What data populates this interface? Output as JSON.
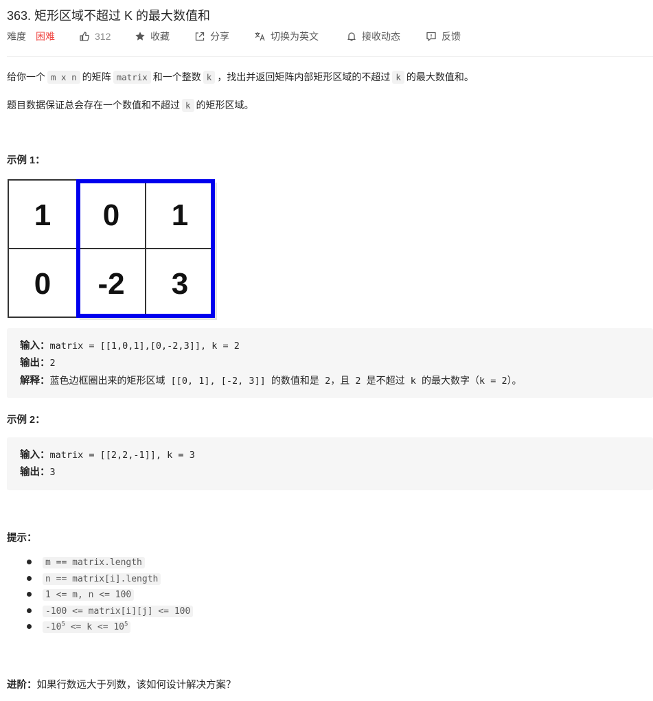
{
  "problem": {
    "title": "363. 矩形区域不超过 K 的最大数值和",
    "difficulty_label": "难度",
    "difficulty_value": "困难",
    "likes": "312",
    "favorite_label": "收藏",
    "share_label": "分享",
    "switch_lang_label": "切换为英文",
    "notify_label": "接收动态",
    "feedback_label": "反馈"
  },
  "description": {
    "p1_a": "给你一个",
    "p1_code_mxn": "m x n",
    "p1_b": "的矩阵",
    "p1_code_matrix": "matrix",
    "p1_c": "和一个整数",
    "p1_code_k": "k",
    "p1_d": "，找出并返回矩阵内部矩形区域的不超过",
    "p1_code_k2": "k",
    "p1_e": "的最大数值和。",
    "p2_a": "题目数据保证总会存在一个数值和不超过",
    "p2_code_k": "k",
    "p2_b": "的矩形区域。"
  },
  "example1": {
    "heading": "示例 1：",
    "matrix": [
      [
        "1",
        "0",
        "1"
      ],
      [
        "0",
        "-2",
        "3"
      ]
    ],
    "input_label": "输入：",
    "input_value": "matrix = [[1,0,1],[0,-2,3]], k = 2",
    "output_label": "输出：",
    "output_value": "2",
    "explain_label": "解释：",
    "explain_a": "蓝色边框圈出来的矩形区域",
    "explain_code1": " [[0, 1], [-2, 3]] ",
    "explain_b": "的数值和是",
    "explain_code2": " 2",
    "explain_c": "，且",
    "explain_code3": " 2 ",
    "explain_d": "是不超过",
    "explain_code4": " k ",
    "explain_e": "的最大数字（",
    "explain_code5": "k = 2",
    "explain_f": "）。"
  },
  "example2": {
    "heading": "示例 2：",
    "input_label": "输入：",
    "input_value": "matrix = [[2,2,-1]], k = 3",
    "output_label": "输出：",
    "output_value": "3"
  },
  "hints": {
    "heading": "提示：",
    "items": [
      "m == matrix.length",
      "n == matrix[i].length",
      "1 <= m, n <= 100",
      "-100 <= matrix[i][j] <= 100"
    ],
    "last_a": "-10",
    "last_sup1": "5",
    "last_b": " <= k <= 10",
    "last_sup2": "5"
  },
  "advanced": {
    "label": "进阶：",
    "text": "如果行数远大于列数，该如何设计解决方案？"
  },
  "colors": {
    "difficulty_hard": "#ef4743",
    "highlight_border": "#0000ee"
  }
}
